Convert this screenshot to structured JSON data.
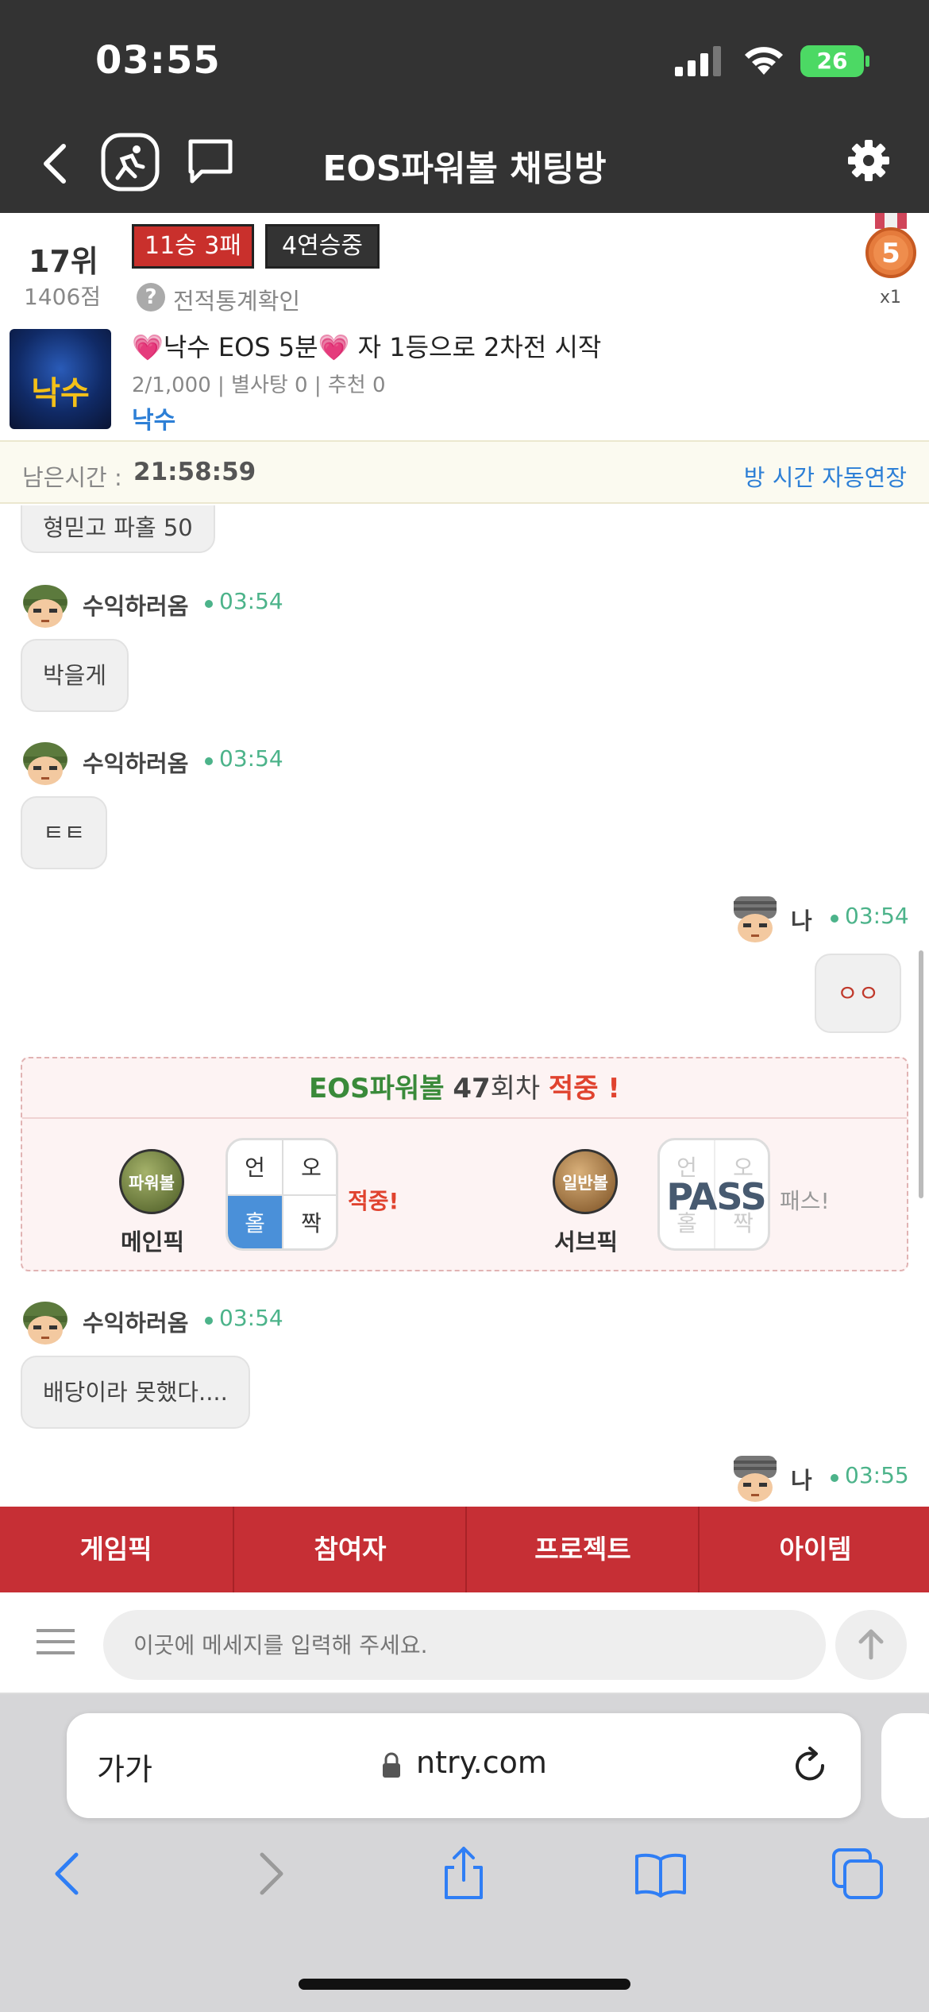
{
  "status_bar": {
    "time": "03:55",
    "battery": "26"
  },
  "header": {
    "title": "EOS파워볼 채팅방"
  },
  "profile": {
    "rank": "17위",
    "score": "1406점",
    "record_badge": "11승 3패",
    "streak_badge": "4연승중",
    "stats_link": "전적통계확인",
    "medal_number": "5",
    "medal_multiplier": "x1"
  },
  "room": {
    "thumb_text": "낙수",
    "name": "💗낙수 EOS 5분💗 자 1등으로 2차전 시작",
    "meta": "2/1,000 | 별사탕 0 | 추천 0",
    "owner": "낙수"
  },
  "timer": {
    "label": "남은시간 :",
    "value": "21:58:59",
    "extend": "방 시간 자동연장"
  },
  "messages": [
    {
      "text": "형믿고 파홀 50"
    },
    {
      "sender": "수익하러옴",
      "time": "03:54",
      "text": "박을게"
    },
    {
      "sender": "수익하러옴",
      "time": "03:54",
      "text": "ㅌㅌ"
    },
    {
      "sender": "나",
      "time": "03:54",
      "text": "ㅇㅇ"
    },
    {
      "sender": "수익하러옴",
      "time": "03:54",
      "text": "배당이라 못했다...."
    },
    {
      "sender": "나",
      "time": "03:55"
    }
  ],
  "result": {
    "game": "EOS파워볼",
    "round": "47",
    "round_suffix": "회차",
    "hit": "적중 !",
    "main_icon": "파워볼",
    "main_label": "메인픽",
    "main_cells": [
      "언",
      "오",
      "홀",
      "짝"
    ],
    "main_result": "적중!",
    "sub_icon": "일반볼",
    "sub_label": "서브픽",
    "sub_cells": [
      "언",
      "오",
      "홀",
      "짝"
    ],
    "sub_stamp": "PASS",
    "sub_result": "패스!"
  },
  "tabs": [
    "게임픽",
    "참여자",
    "프로젝트",
    "아이템"
  ],
  "input": {
    "placeholder": "이곳에 메세지를 입력해 주세요."
  },
  "safari": {
    "aa": "가가",
    "url": "ntry.com"
  },
  "colors": {
    "accent_red": "#c62f35",
    "time_green": "#4cb38a",
    "link_blue": "#2d7fd6",
    "hit_green": "#3a8a3a"
  },
  "icons": [
    "back-icon",
    "running-icon",
    "chat-icon",
    "gear-icon",
    "help-icon",
    "medal-icon",
    "avatar-icon",
    "menu-icon",
    "arrow-up-icon",
    "lock-icon",
    "reload-icon",
    "share-icon",
    "bookmarks-icon",
    "tabs-icon"
  ]
}
